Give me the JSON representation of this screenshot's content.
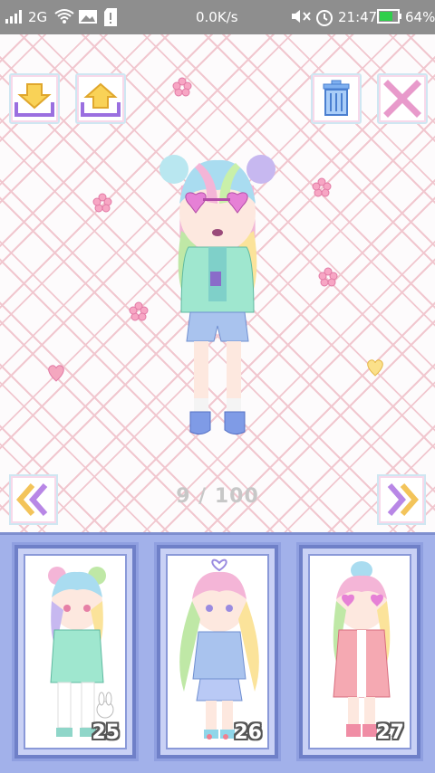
{
  "status_bar": {
    "network": "2G",
    "speed": "0.0K/s",
    "time": "21:47",
    "battery": "64%",
    "icons": [
      "signal-icon",
      "wifi-icon",
      "image-icon",
      "sd-card-icon",
      "mute-icon",
      "alarm-icon",
      "battery-icon"
    ]
  },
  "toolbar": {
    "save_icon": "download-tray-icon",
    "load_icon": "upload-tray-icon",
    "delete_icon": "trash-icon",
    "close_icon": "close-x-icon"
  },
  "stage": {
    "counter": "9 / 100",
    "prev_icon": "double-chevron-left-icon",
    "next_icon": "double-chevron-right-icon",
    "background": "pink-lattice-pattern"
  },
  "slots": [
    {
      "number": "25"
    },
    {
      "number": "26"
    },
    {
      "number": "27"
    }
  ],
  "colors": {
    "status_bar": "#8e8e8e",
    "lattice": "#f1c7cf",
    "panel": "#a2b1ea",
    "card_border": "#6f80c8",
    "arrow_gold": "#f3c45a",
    "arrow_purple": "#b887e6"
  }
}
